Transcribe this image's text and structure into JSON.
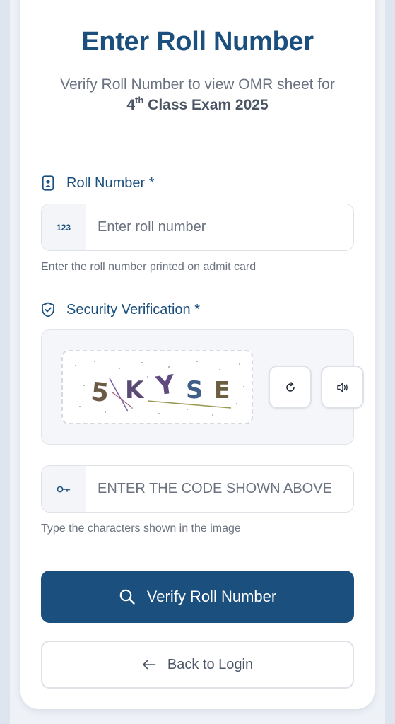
{
  "header": {
    "title": "Enter Roll Number",
    "subtitle": "Verify Roll Number to view OMR sheet for",
    "exam_number": "4",
    "exam_sup": "th",
    "exam_rest": " Class Exam 2025"
  },
  "roll": {
    "label": "Roll Number *",
    "icon": "id-badge-icon",
    "prefix": "123",
    "placeholder": "Enter roll number",
    "hint": "Enter the roll number printed on admit card"
  },
  "security": {
    "label": "Security Verification *",
    "icon": "shield-check-icon",
    "captcha_text": "5KYSE",
    "refresh_icon": "refresh-icon",
    "audio_icon": "speaker-icon"
  },
  "code": {
    "prefix_icon": "key-icon",
    "placeholder": "ENTER THE CODE SHOWN ABOVE",
    "hint": "Type the characters shown in the image"
  },
  "actions": {
    "verify_label": "Verify Roll Number",
    "verify_icon": "search-icon",
    "back_label": "Back to Login",
    "back_icon": "arrow-left-icon"
  },
  "colors": {
    "primary": "#1b4f7e",
    "muted_text": "#6b7280",
    "background": "#dfe5ee"
  }
}
